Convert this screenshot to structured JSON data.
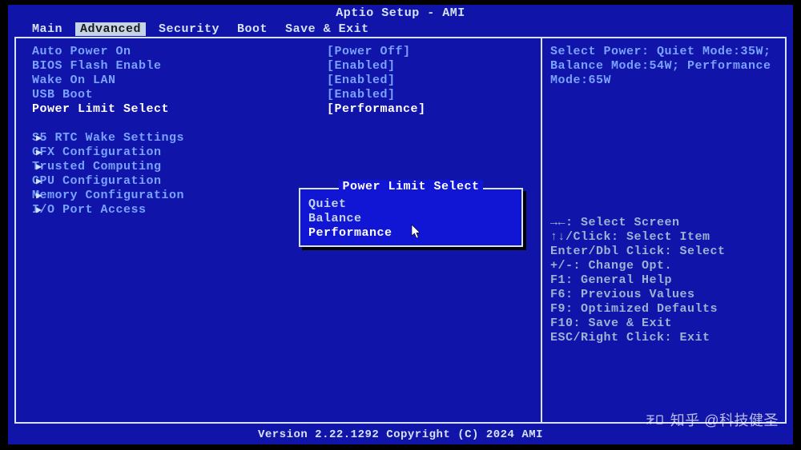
{
  "title": "Aptio Setup - AMI",
  "tabs": [
    "Main",
    "Advanced",
    "Security",
    "Boot",
    "Save & Exit"
  ],
  "active_tab_index": 1,
  "settings": [
    {
      "label": "Auto Power On",
      "value": "[Power Off]",
      "selected": false
    },
    {
      "label": "BIOS Flash Enable",
      "value": "[Enabled]",
      "selected": false
    },
    {
      "label": "Wake On LAN",
      "value": "[Enabled]",
      "selected": false
    },
    {
      "label": "USB Boot",
      "value": "[Enabled]",
      "selected": false
    },
    {
      "label": "Power Limit Select",
      "value": "[Performance]",
      "selected": true
    }
  ],
  "submenus": [
    "S5 RTC Wake Settings",
    "GFX Configuration",
    "Trusted Computing",
    "CPU Configuration",
    "Memory Configuration",
    "I/O Port Access"
  ],
  "popup": {
    "title": "Power Limit Select",
    "options": [
      "Quiet",
      "Balance",
      "Performance"
    ],
    "selected_index": 2
  },
  "help_text": "Select Power: Quiet Mode:35W; Balance Mode:54W; Performance Mode:65W",
  "key_help": [
    "→←: Select Screen",
    "↑↓/Click: Select Item",
    "Enter/Dbl Click: Select",
    "+/-: Change Opt.",
    "F1: General Help",
    "F6: Previous Values",
    "F9: Optimized Defaults",
    "F10: Save & Exit",
    "ESC/Right Click: Exit"
  ],
  "footer": "Version 2.22.1292 Copyright (C) 2024 AMI",
  "watermark": "知乎 @科技健圣"
}
